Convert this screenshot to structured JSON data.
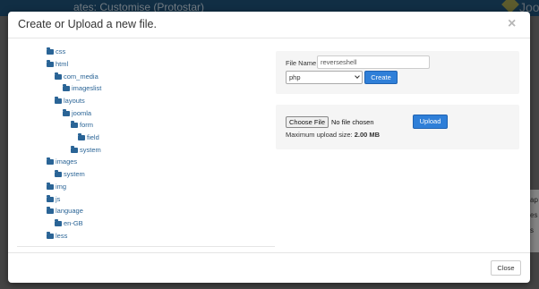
{
  "background": {
    "title": "ates: Customise (Protostar)",
    "logo_text": "Joo",
    "side_fragments": [
      "ap",
      "es",
      "s"
    ]
  },
  "modal": {
    "title": "Create or Upload a new file.",
    "close_icon_glyph": "×"
  },
  "tree": [
    {
      "label": "css"
    },
    {
      "label": "html"
    },
    {
      "label": "com_media"
    },
    {
      "label": "imageslist"
    },
    {
      "label": "layouts"
    },
    {
      "label": "joomla"
    },
    {
      "label": "form"
    },
    {
      "label": "field"
    },
    {
      "label": "system"
    },
    {
      "label": "images"
    },
    {
      "label": "system"
    },
    {
      "label": "img"
    },
    {
      "label": "js"
    },
    {
      "label": "language"
    },
    {
      "label": "en-GB"
    },
    {
      "label": "less"
    }
  ],
  "create_form": {
    "file_name_label": "File Name",
    "file_name_value": "reverseshell",
    "extension_selected": "php",
    "create_button": "Create"
  },
  "upload_form": {
    "choose_file_button": "Choose File",
    "file_status": "No file chosen",
    "upload_button": "Upload",
    "max_label": "Maximum upload size:",
    "max_value": "2.00 MB"
  },
  "footer": {
    "close_button": "Close"
  },
  "colors": {
    "link": "#2a6496",
    "primary": "#2f7fd8",
    "well": "#f5f5f5"
  }
}
